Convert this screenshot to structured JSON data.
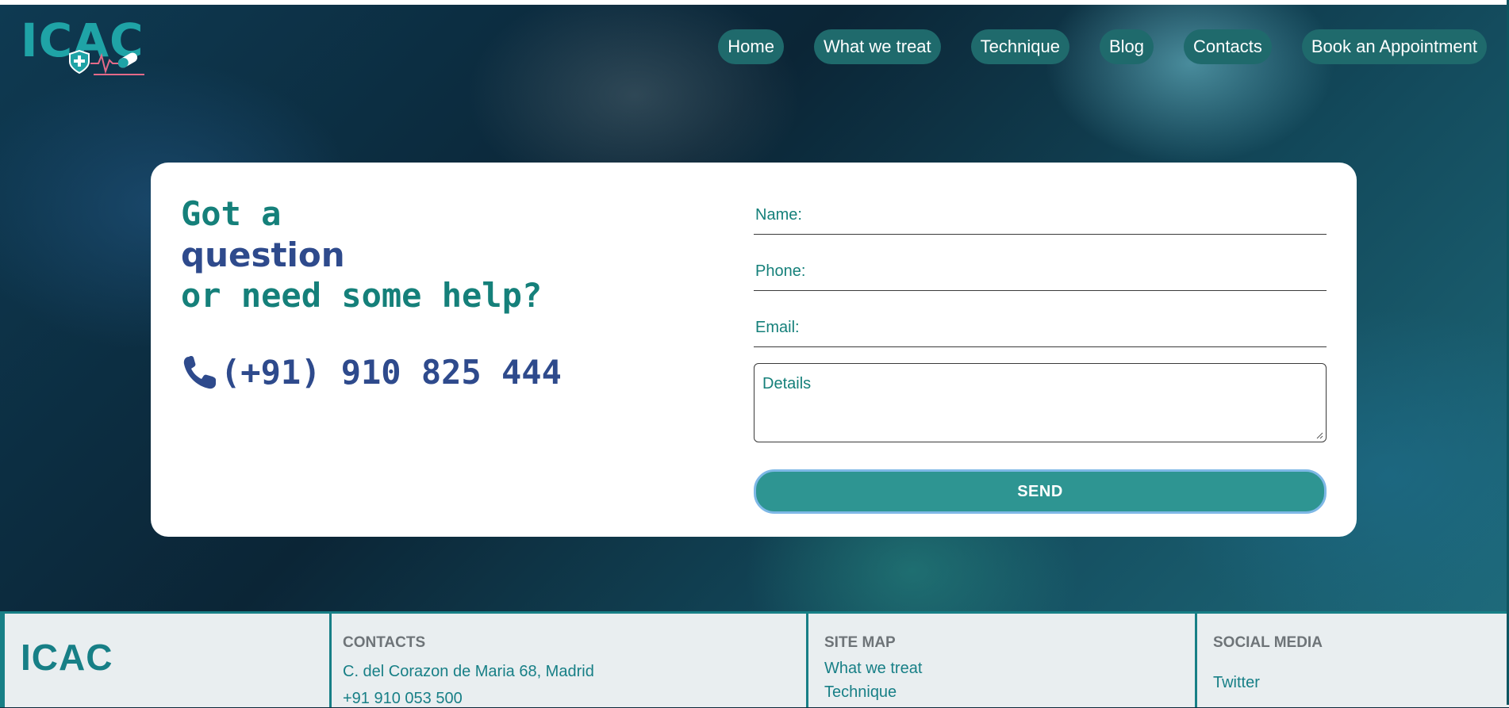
{
  "brand": {
    "logo_text": "ICAC",
    "accent": "#1fa3a6",
    "dark_teal": "#1f6a6c"
  },
  "nav": {
    "items": [
      {
        "label": "Home"
      },
      {
        "label": "What we treat"
      },
      {
        "label": "Technique"
      },
      {
        "label": "Blog"
      },
      {
        "label": "Contacts"
      },
      {
        "label": "Book an Appointment"
      }
    ]
  },
  "contact_card": {
    "headline_line1": "Got a",
    "headline_line2": "question",
    "headline_line3": "or need some help?",
    "phone_icon": "phone-icon",
    "phone_number": "(+91) 910 825 444"
  },
  "form": {
    "name_placeholder": "Name:",
    "phone_placeholder": "Phone:",
    "email_placeholder": "Email:",
    "details_placeholder": "Details",
    "send_label": "SEND",
    "send_color": "#2e9592"
  },
  "footer": {
    "logo_text": "ICAC",
    "contacts": {
      "heading": "CONTACTS",
      "address": "C. del Corazon de Maria 68, Madrid",
      "phone": "+91 910 053 500"
    },
    "sitemap": {
      "heading": "SITE MAP",
      "links": [
        "What we treat",
        "Technique"
      ]
    },
    "social": {
      "heading": "SOCIAL MEDIA",
      "links": [
        "Twitter"
      ]
    }
  }
}
